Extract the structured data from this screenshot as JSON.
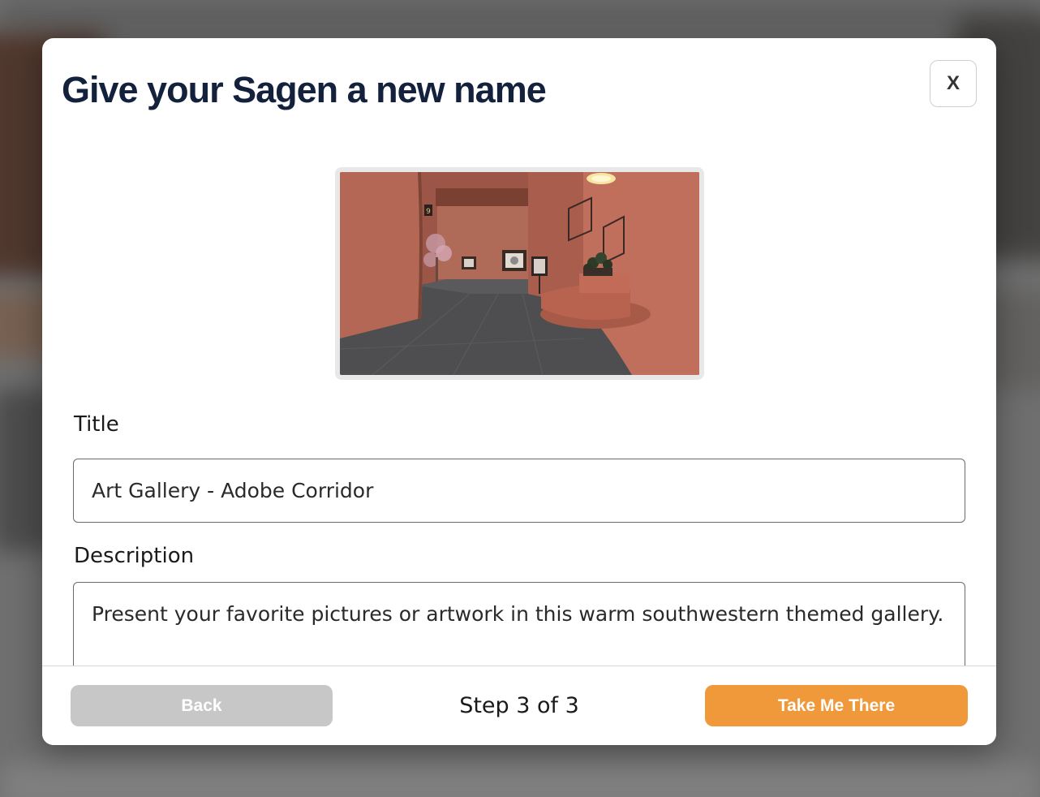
{
  "modal": {
    "title": "Give your Sagen a new name",
    "close_label": "X"
  },
  "preview": {
    "image": "art-gallery-adobe-corridor-thumbnail"
  },
  "form": {
    "title_label": "Title",
    "title_value": "Art Gallery - Adobe Corridor",
    "description_label": "Description",
    "description_value": "Present your favorite pictures or artwork in this warm southwestern themed gallery."
  },
  "footer": {
    "back_label": "Back",
    "step_text": "Step 3 of 3",
    "primary_label": "Take Me There"
  },
  "colors": {
    "title_text": "#14213d",
    "primary_button": "#f0993a",
    "disabled_button": "#c7c7c7",
    "gallery_wall": "#b86a58",
    "gallery_floor": "#4e4e50"
  }
}
